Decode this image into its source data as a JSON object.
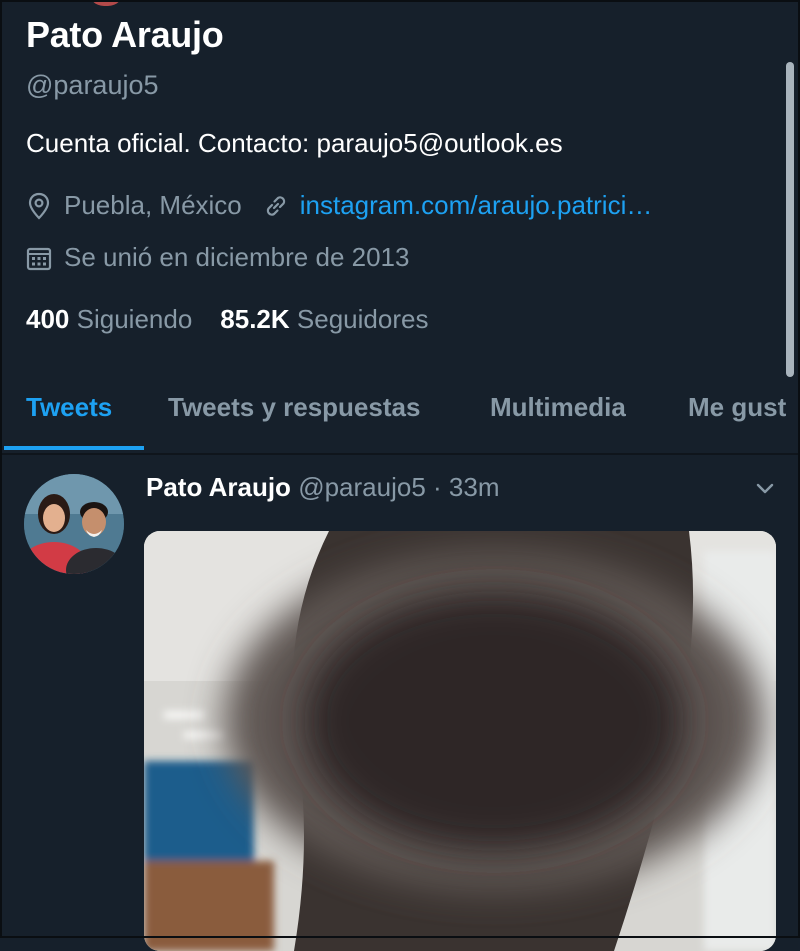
{
  "profile": {
    "name": "Pato Araujo",
    "handle": "@paraujo5",
    "bio": "Cuenta oficial. Contacto: paraujo5@outlook.es",
    "location": "Puebla, México",
    "website": "instagram.com/araujo.patrici…",
    "joined": "Se unió en diciembre de 2013",
    "following_count": "400",
    "following_label": "Siguiendo",
    "followers_count": "85.2K",
    "followers_label": "Seguidores"
  },
  "tabs": [
    {
      "label": "Tweets",
      "active": true
    },
    {
      "label": "Tweets y respuestas",
      "active": false
    },
    {
      "label": "Multimedia",
      "active": false
    },
    {
      "label": "Me gust",
      "active": false
    }
  ],
  "tweet": {
    "author_name": "Pato Araujo",
    "author_handle": "@paraujo5",
    "separator": "·",
    "time": "33m"
  },
  "icons": {
    "location": "location-pin-icon",
    "link": "link-icon",
    "calendar": "calendar-icon",
    "more": "chevron-down-icon"
  },
  "colors": {
    "background": "#16202b",
    "accent": "#1da1f2",
    "secondary_text": "#8899a6",
    "primary_text": "#ffffff"
  }
}
